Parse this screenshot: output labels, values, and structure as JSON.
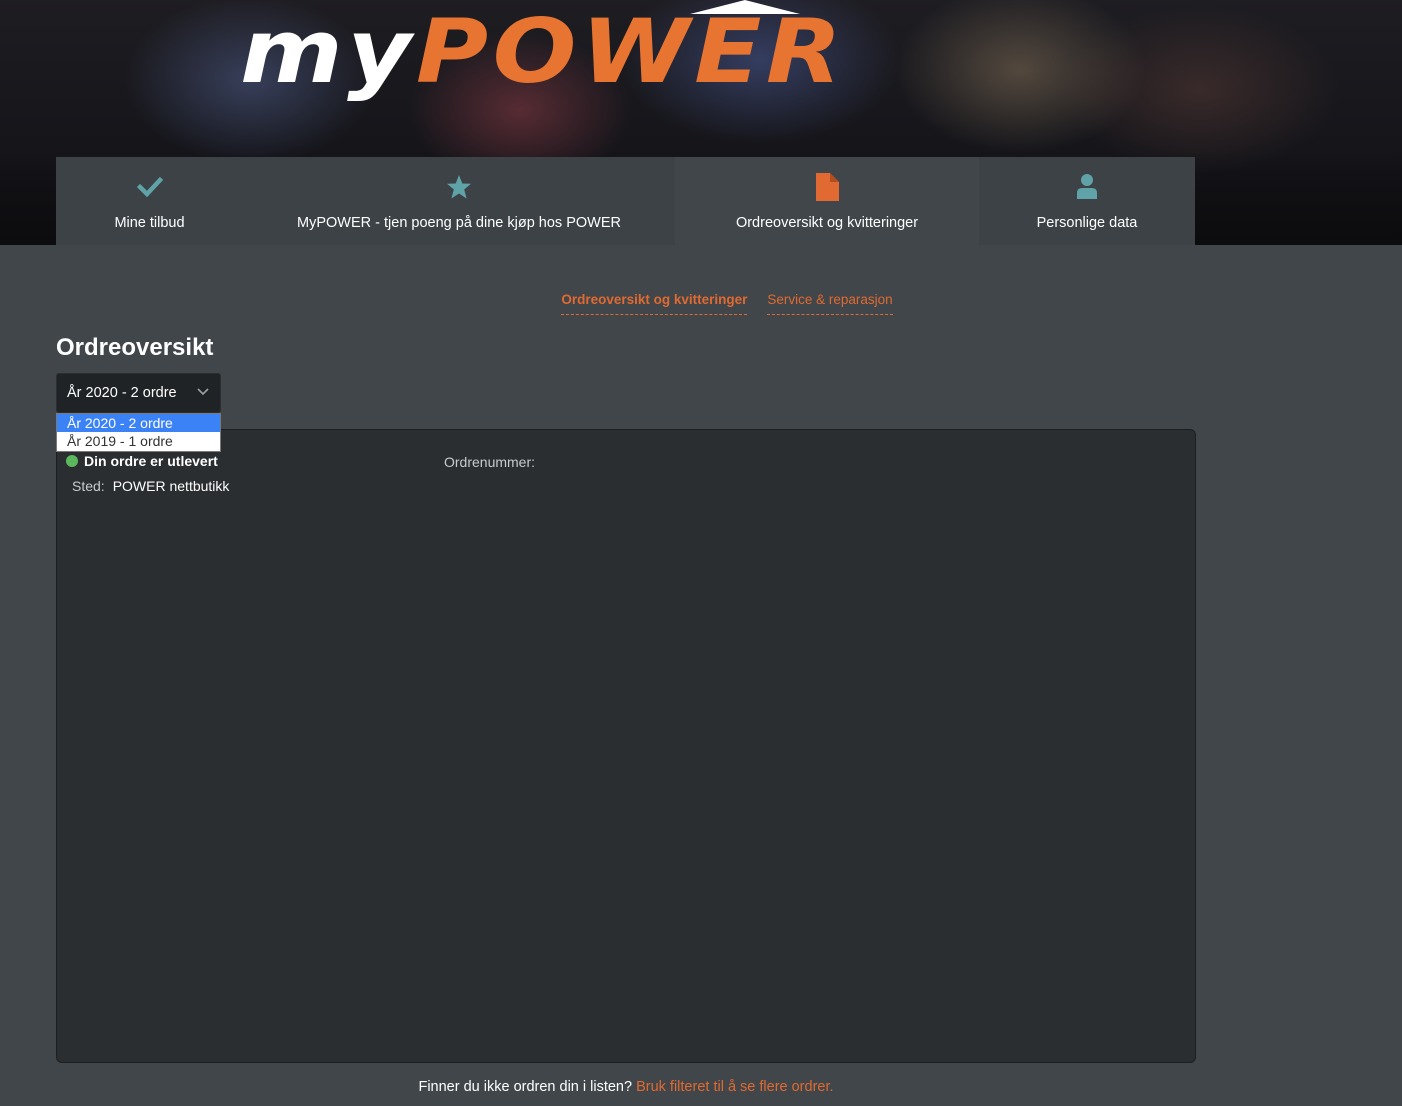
{
  "brand": {
    "logo_my": "my",
    "logo_power": "POWER",
    "accent_color": "#e87431"
  },
  "nav": {
    "items": [
      {
        "label": "Mine tilbud",
        "icon": "checkmark-icon"
      },
      {
        "label": "MyPOWER - tjen poeng på dine kjøp hos POWER",
        "icon": "star-icon"
      },
      {
        "label": "Ordreoversikt og kvitteringer",
        "icon": "document-icon",
        "active": true
      },
      {
        "label": "Personlige data",
        "icon": "person-icon"
      }
    ]
  },
  "subtabs": {
    "orders": "Ordreoversikt og kvitteringer",
    "service": "Service & reparasjon"
  },
  "page": {
    "title": "Ordreoversikt"
  },
  "year_filter": {
    "selected": "År 2020 - 2 ordre",
    "options": [
      "År 2020 - 2 ordre",
      "År 2019 - 1 ordre"
    ]
  },
  "order": {
    "status": "Din ordre er utlevert",
    "status_color": "#5cb85c",
    "location_label": "Sted:",
    "location_value": "POWER nettbutikk",
    "order_number_label": "Ordrenummer:"
  },
  "footer": {
    "text": "Finner du ikke ordren din i listen?",
    "link": "Bruk filteret til å se flere ordrer."
  }
}
